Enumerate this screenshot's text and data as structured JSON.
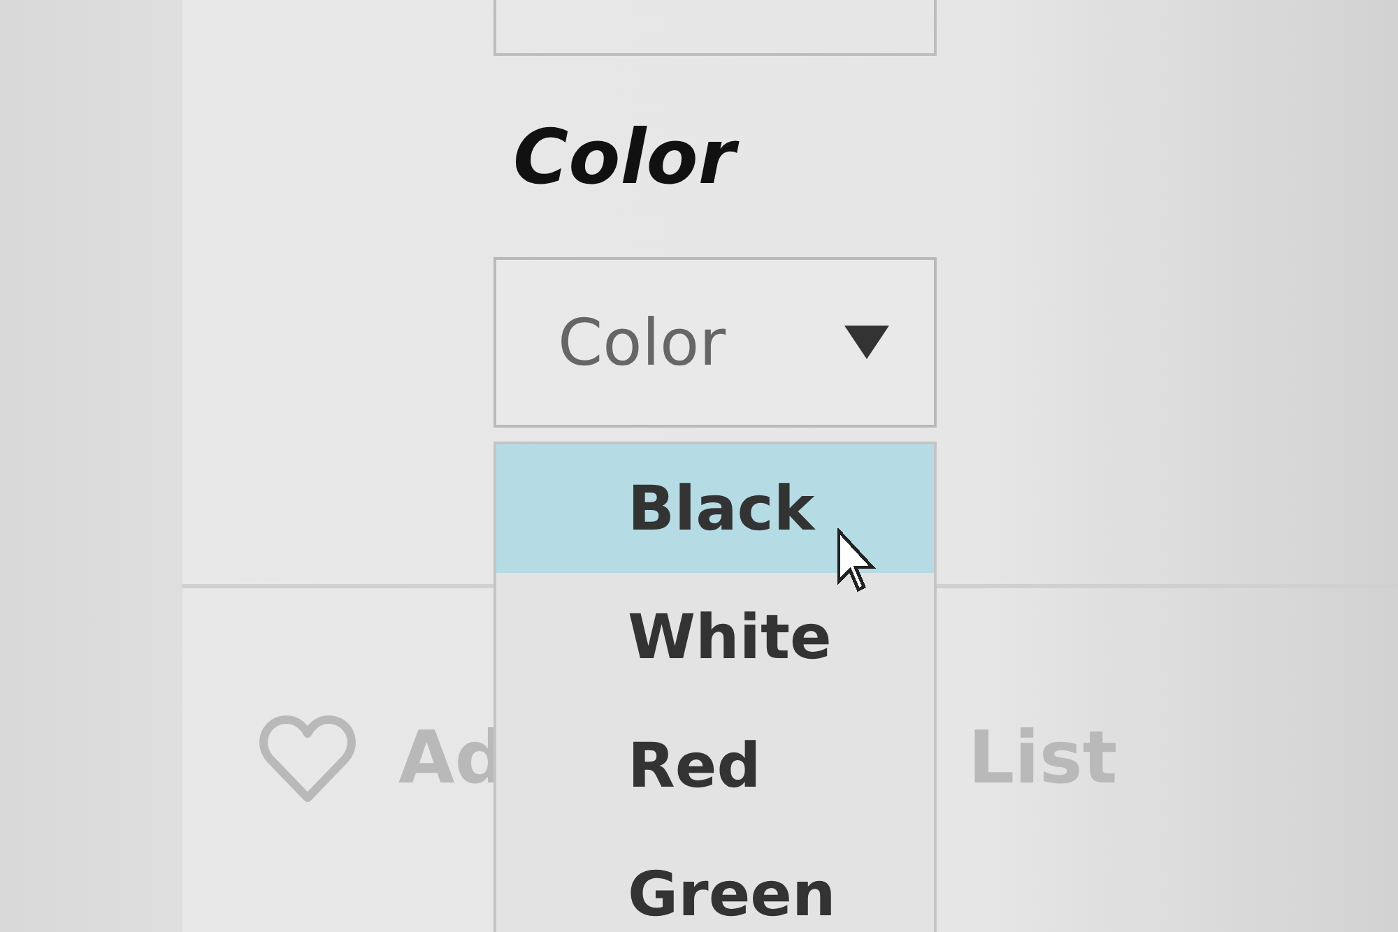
{
  "color_label": "Color",
  "color_select": {
    "value": "Color"
  },
  "color_options": [
    {
      "label": "Black",
      "selected": true
    },
    {
      "label": "White",
      "selected": false
    },
    {
      "label": "Red",
      "selected": false
    },
    {
      "label": "Green",
      "selected": false
    }
  ],
  "wish_button": {
    "label_start": "Ad",
    "label_end": "List"
  }
}
